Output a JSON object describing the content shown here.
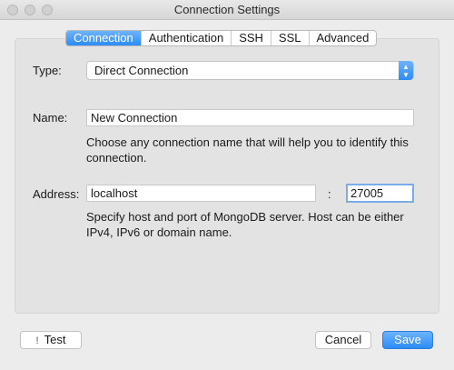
{
  "window": {
    "title": "Connection Settings"
  },
  "tabs": [
    {
      "label": "Connection",
      "active": true
    },
    {
      "label": "Authentication",
      "active": false
    },
    {
      "label": "SSH",
      "active": false
    },
    {
      "label": "SSL",
      "active": false
    },
    {
      "label": "Advanced",
      "active": false
    }
  ],
  "form": {
    "type_label": "Type:",
    "type_value": "Direct Connection",
    "name_label": "Name:",
    "name_value": "New Connection",
    "name_hint_line1": "Choose any connection name that will help you to identify this",
    "name_hint_line2": "connection.",
    "address_label": "Address:",
    "host_value": "localhost",
    "separator": ":",
    "port_value": "27005",
    "address_hint_line1": "Specify host and port of MongoDB server. Host can be either",
    "address_hint_line2": "IPv4, IPv6 or domain name."
  },
  "buttons": {
    "test_icon": "!",
    "test_label": "Test",
    "cancel_label": "Cancel",
    "save_label": "Save"
  },
  "colors": {
    "accent": "#2d8cf6"
  }
}
